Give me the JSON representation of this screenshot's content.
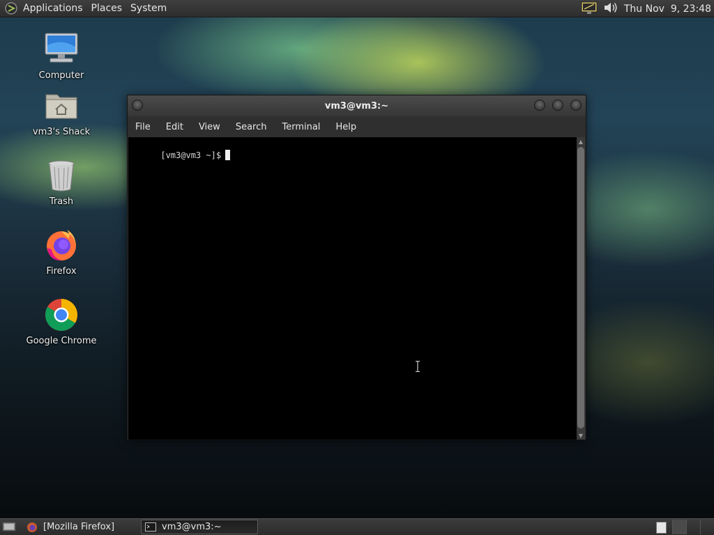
{
  "top_panel": {
    "menus": [
      "Applications",
      "Places",
      "System"
    ],
    "clock": "Thu Nov  9, 23:48",
    "tray_icons": [
      "display-settings-icon",
      "volume-icon"
    ]
  },
  "desktop": {
    "icons": [
      {
        "label": "Computer",
        "icon": "computer-icon"
      },
      {
        "label": "vm3's Shack",
        "icon": "home-folder-icon"
      },
      {
        "label": "Trash",
        "icon": "trash-icon"
      },
      {
        "label": "Firefox",
        "icon": "firefox-icon"
      },
      {
        "label": "Google Chrome",
        "icon": "chrome-icon"
      }
    ]
  },
  "terminal": {
    "title": "vm3@vm3:~",
    "menu": [
      "File",
      "Edit",
      "View",
      "Search",
      "Terminal",
      "Help"
    ],
    "prompt": "[vm3@vm3 ~]$"
  },
  "taskbar": {
    "items": [
      {
        "label": "[Mozilla Firefox]",
        "icon": "firefox-icon",
        "active": false
      },
      {
        "label": "vm3@vm3:~",
        "icon": "terminal-icon",
        "active": true
      }
    ]
  },
  "colors": {
    "panel": "#333333",
    "terminal_bg": "#000000",
    "terminal_text": "#d8d8d8"
  }
}
